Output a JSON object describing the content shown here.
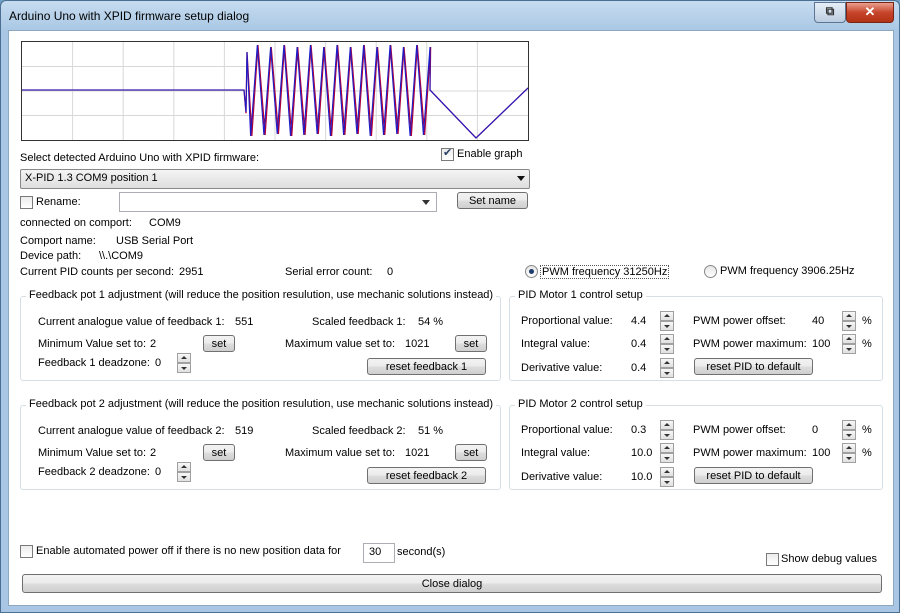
{
  "window": {
    "title": "Arduino Uno with XPID firmware setup dialog",
    "restore_icon": "restore-icon",
    "close_icon": "close-icon"
  },
  "graph": {
    "enable_label": "Enable graph",
    "enabled": true,
    "colors": {
      "series_a": "#b0003a",
      "series_b": "#1c1cc8",
      "grid": "#d8d8d8"
    }
  },
  "device": {
    "select_label": "Select detected Arduino Uno with XPID firmware:",
    "selected": "X-PID 1.3 COM9 position 1",
    "rename_label": "Rename:",
    "rename_checked": false,
    "rename_value": "",
    "set_name_label": "Set name",
    "connected_label": "connected on comport:",
    "connected_value": "COM9",
    "comport_name_label": "Comport name:",
    "comport_name_value": "USB Serial Port",
    "device_path_label": "Device path:",
    "device_path_value": "\\\\.\\COM9",
    "pid_counts_label": "Current PID counts per second:",
    "pid_counts_value": "2951",
    "serial_error_label": "Serial error count:",
    "serial_error_value": "0"
  },
  "pwm": {
    "option1": "PWM frequency 31250Hz",
    "option2": "PWM frequency 3906.25Hz",
    "selected": 1
  },
  "feedback1": {
    "title": "Feedback pot 1 adjustment (will reduce the position resulution, use mechanic solutions instead)",
    "current_label": "Current analogue value of feedback 1:",
    "current_value": "551",
    "scaled_label": "Scaled feedback 1:",
    "scaled_value": "54 %",
    "min_label": "Minimum Value set to:",
    "min_value": "2",
    "max_label": "Maximum value set to:",
    "max_value": "1021",
    "set_label": "set",
    "deadzone_label": "Feedback 1 deadzone:",
    "deadzone_value": "0",
    "reset_label": "reset feedback 1"
  },
  "feedback2": {
    "title": "Feedback pot 2 adjustment (will reduce the position resulution, use mechanic solutions instead)",
    "current_label": "Current analogue value of feedback 2:",
    "current_value": "519",
    "scaled_label": "Scaled feedback 2:",
    "scaled_value": "51 %",
    "min_label": "Minimum Value set to:",
    "min_value": "2",
    "max_label": "Maximum value set to:",
    "max_value": "1021",
    "set_label": "set",
    "deadzone_label": "Feedback 2 deadzone:",
    "deadzone_value": "0",
    "reset_label": "reset feedback 2"
  },
  "pid1": {
    "title": "PID Motor 1 control setup",
    "p_label": "Proportional value:",
    "p_value": "4.4",
    "i_label": "Integral value:",
    "i_value": "0.4",
    "d_label": "Derivative value:",
    "d_value": "0.4",
    "offset_label": "PWM power offset:",
    "offset_value": "40",
    "max_label": "PWM power maximum:",
    "max_value": "100",
    "unit": "%",
    "reset_label": "reset PID to default"
  },
  "pid2": {
    "title": "PID Motor 2 control setup",
    "p_label": "Proportional value:",
    "p_value": "0.3",
    "i_label": "Integral value:",
    "i_value": "10.0",
    "d_label": "Derivative value:",
    "d_value": "10.0",
    "offset_label": "PWM power offset:",
    "offset_value": "0",
    "max_label": "PWM power maximum:",
    "max_value": "100",
    "unit": "%",
    "reset_label": "reset PID to default"
  },
  "footer": {
    "auto_off_label": "Enable automated power off if there is no new position data for",
    "auto_off_checked": false,
    "auto_off_seconds": "30",
    "seconds_label": "second(s)",
    "debug_label": "Show debug values",
    "debug_checked": false,
    "close_label": "Close dialog"
  }
}
